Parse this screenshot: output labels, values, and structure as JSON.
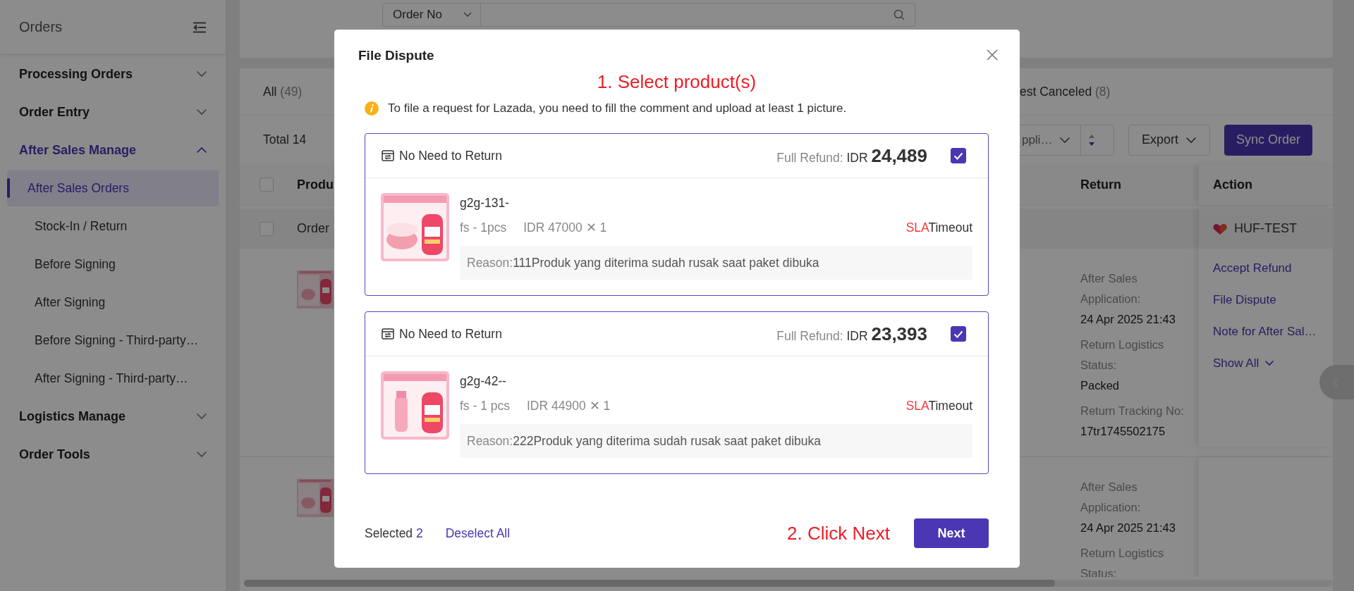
{
  "sidebar": {
    "title": "Orders",
    "groups": [
      {
        "label": "Processing Orders",
        "expanded": false,
        "selected": false
      },
      {
        "label": "Order Entry",
        "expanded": false,
        "selected": false
      },
      {
        "label": "After Sales Manage",
        "expanded": true,
        "selected": true,
        "children": [
          {
            "label": "After Sales Orders",
            "selected": true
          },
          {
            "label": "Stock-In / Return",
            "selected": false
          },
          {
            "label": "Before Signing",
            "selected": false
          },
          {
            "label": "After Signing",
            "selected": false
          },
          {
            "label": "Before Signing - Third-party…",
            "selected": false
          },
          {
            "label": "After Signing - Third-party…",
            "selected": false
          }
        ]
      },
      {
        "label": "Logistics Manage",
        "expanded": false,
        "selected": false
      },
      {
        "label": "Order Tools",
        "expanded": false,
        "selected": false
      }
    ]
  },
  "filter": {
    "field": "Order No"
  },
  "tabs": [
    {
      "label": "All",
      "count": "(49)"
    },
    {
      "label": "est Canceled",
      "count": "(8)"
    }
  ],
  "toolbar": {
    "total": "Total 14",
    "sort": "ppli…",
    "export": "Export",
    "sync": "Sync Order"
  },
  "table": {
    "select_all": {
      "checked": false
    },
    "columns": [
      {
        "label": "Produ"
      },
      {
        "label": "Return"
      },
      {
        "label": "Action"
      }
    ],
    "group_row": {
      "checked": false,
      "label": "Order",
      "store": "HUF-TEST"
    },
    "rows": [
      {
        "image": {
          "kind": "picture"
        },
        "return_info": [
          {
            "label": "After Sales Application:",
            "value": "24 Apr 2025 21:43"
          },
          {
            "label": "Return Logistics Status:",
            "value": "Packed"
          },
          {
            "label": "Return Tracking No:",
            "value": "17tr1745502175"
          }
        ],
        "actions": [
          {
            "label": "Accept Refund",
            "kind": "link"
          },
          {
            "label": "File Dispute",
            "kind": "link"
          },
          {
            "label": "Note for After Sal…",
            "kind": "link"
          },
          {
            "label": "Show All",
            "kind": "more"
          }
        ]
      },
      {
        "image": {
          "kind": "picture"
        },
        "return_info": [
          {
            "label": "After Sales Application:",
            "value": "24 Apr 2025 21:43"
          },
          {
            "label": "Return Logistics Status:"
          }
        ],
        "actions": []
      }
    ]
  },
  "modal": {
    "title": "File Dispute",
    "step_1": "1. Select product(s)",
    "notice": "To file a request for Lazada, you need to fill the comment and upload at least 1 picture.",
    "items": [
      {
        "return_type": "No Need to Return",
        "refund_label": "Full Refund:",
        "currency": "IDR",
        "amount": "24,489",
        "checked": true,
        "image": {
          "kind": "picture"
        },
        "sku": "g2g-131-",
        "variant": "fs - 1pcs",
        "price": "IDR 47000",
        "quantity": "✕ 1",
        "sla": "SLA",
        "sla_status": "Timeout",
        "reason_label": "Reason:",
        "reason": "111Produk yang diterima sudah rusak saat paket dibuka"
      },
      {
        "return_type": "No Need to Return",
        "refund_label": "Full Refund:",
        "currency": "IDR",
        "amount": "23,393",
        "checked": true,
        "image": {
          "kind": "picture"
        },
        "sku": "g2g-42--",
        "variant": "fs - 1 pcs",
        "price": "IDR 44900",
        "quantity": "✕ 1",
        "sla": "SLA",
        "sla_status": "Timeout",
        "reason_label": "Reason:",
        "reason": "222Produk yang diterima sudah rusak saat paket dibuka"
      }
    ],
    "selected_label": "Selected",
    "selected_count": "2",
    "deselect": "Deselect All",
    "step_2": "2. Click Next",
    "next": "Next"
  }
}
